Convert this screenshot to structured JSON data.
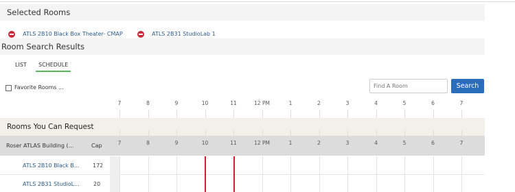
{
  "selected_rooms": {
    "title": "Selected Rooms",
    "items": [
      {
        "label": "ATLS 2B10 Black Box Theater- CMAP"
      },
      {
        "label": "ATLS 2B31 StudioLab 1"
      }
    ]
  },
  "search_results": {
    "title": "Room Search Results",
    "tabs": [
      {
        "label": "LIST",
        "active": false
      },
      {
        "label": "SCHEDULE",
        "active": true
      }
    ]
  },
  "filters": {
    "favorite_label": "Favorite Rooms ...",
    "favorite_checked": false,
    "find_placeholder": "Find A Room",
    "search_label": "Search"
  },
  "time_axis": [
    "7",
    "8",
    "9",
    "10",
    "11",
    "12 PM",
    "1",
    "2",
    "3",
    "4",
    "5",
    "6",
    "7"
  ],
  "group": {
    "title": "Rooms You Can Request",
    "building": "Roser ATLAS Building (...",
    "cap_header": "Cap",
    "rooms": [
      {
        "name": "ATLS 2B10 Black B...",
        "cap": "172"
      },
      {
        "name": "ATLS 2B31 StudioL...",
        "cap": "20"
      }
    ]
  },
  "colors": {
    "accent": "#2a6ebb",
    "active_tab": "#5cb85c",
    "remove": "#c62f3a",
    "now_line": "#d0202f"
  }
}
